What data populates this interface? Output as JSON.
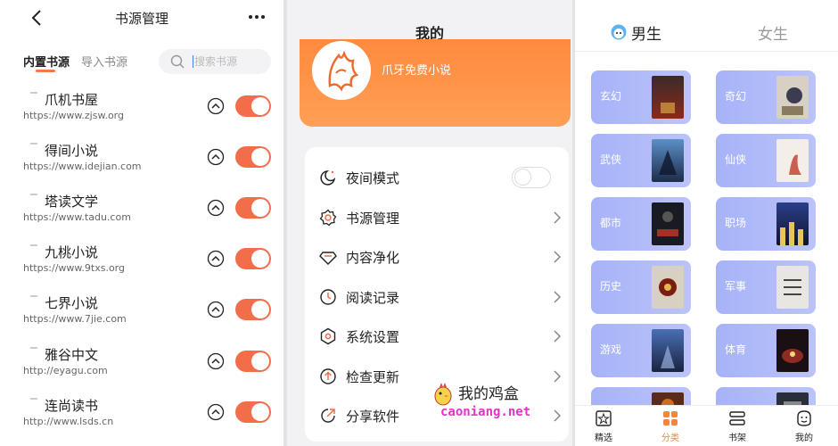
{
  "source_manager": {
    "title": "书源管理",
    "tabs": {
      "builtin": "内置书源",
      "import": "导入书源"
    },
    "search_placeholder": "搜索书源",
    "sources": [
      {
        "name": "爪机书屋",
        "url": "https://www.zjsw.org",
        "enabled": true
      },
      {
        "name": "得间小说",
        "url": "https://www.idejian.com",
        "enabled": true
      },
      {
        "name": "塔读文学",
        "url": "https://www.tadu.com",
        "enabled": true
      },
      {
        "name": "九桃小说",
        "url": "https://www.9txs.org",
        "enabled": true
      },
      {
        "name": "七界小说",
        "url": "https://www.7jie.com",
        "enabled": true
      },
      {
        "name": "雅谷中文",
        "url": "http://eyagu.com",
        "enabled": true
      },
      {
        "name": "连尚读书",
        "url": "http://www.lsds.cn",
        "enabled": true
      }
    ]
  },
  "my_page": {
    "title": "我的",
    "profile_name": "爪牙免费小说",
    "menu": [
      {
        "label": "夜间模式",
        "icon": "moon-icon",
        "night_mode_on": false
      },
      {
        "label": "书源管理",
        "icon": "gear-icon"
      },
      {
        "label": "内容净化",
        "icon": "diamond-icon"
      },
      {
        "label": "阅读记录",
        "icon": "clock-icon"
      },
      {
        "label": "系统设置",
        "icon": "hexagon-settings-icon"
      },
      {
        "label": "检查更新",
        "icon": "arrow-up-circle-icon"
      },
      {
        "label": "分享软件",
        "icon": "share-icon"
      }
    ],
    "watermark": {
      "line1": "我的鸡盒",
      "line2": "caoniang.net"
    }
  },
  "category": {
    "gender_tabs": {
      "male": "男生",
      "female": "女生"
    },
    "male_categories": [
      "玄幻",
      "武侠",
      "都市",
      "历史",
      "游戏"
    ],
    "female_categories": [
      "奇幻",
      "仙侠",
      "职场",
      "军事",
      "体育"
    ],
    "bottom_nav": [
      "精选",
      "分类",
      "书架",
      "我的"
    ],
    "active_nav": "分类"
  },
  "colors": {
    "accent": "#f26e4b",
    "profile_card": "#ff8a3d",
    "category_card": "#a6b3f7",
    "nav_active": "#f7843f"
  }
}
